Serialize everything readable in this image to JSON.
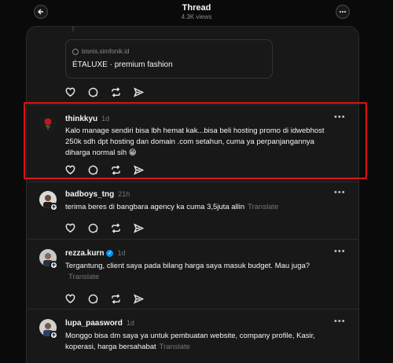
{
  "header": {
    "title": "Thread",
    "views": "4.3K views"
  },
  "link_card": {
    "domain": "bisnis.simfonik.id",
    "title": "ÉTALUXE · premium fashion"
  },
  "posts": [
    {
      "username": "thinkkyu",
      "time": "1d",
      "text": "Kalo manage sendiri bisa lbh hemat kak...bisa beli hosting promo di idwebhost 250k sdh dpt hosting dan domain .com setahun, cuma ya perpanjangannya diharga normal sih 😁",
      "translate": "",
      "avatar_color": "#1b1b1b"
    },
    {
      "username": "badboys_tng",
      "time": "21h",
      "text": "terima beres di bangbara agency ka cuma 3,5juta allin",
      "translate": "Translate",
      "avatar_color": "#6b5a4a"
    },
    {
      "username": "rezza.kurn",
      "time": "1d",
      "text": "Tergantung, client saya pada bilang harga saya masuk budget. Mau juga?",
      "translate": "Translate",
      "avatar_color": "#5a6470",
      "verified": true
    },
    {
      "username": "lupa_paasword",
      "time": "1d",
      "text": "Monggo bisa dm saya ya untuk pembuatan website, company profile, Kasir, koperasi, harga bersahabat",
      "translate": "Translate",
      "avatar_color": "#3a4a6a"
    }
  ],
  "more_label": "•••",
  "plus_label": "+",
  "verified_label": "✓"
}
